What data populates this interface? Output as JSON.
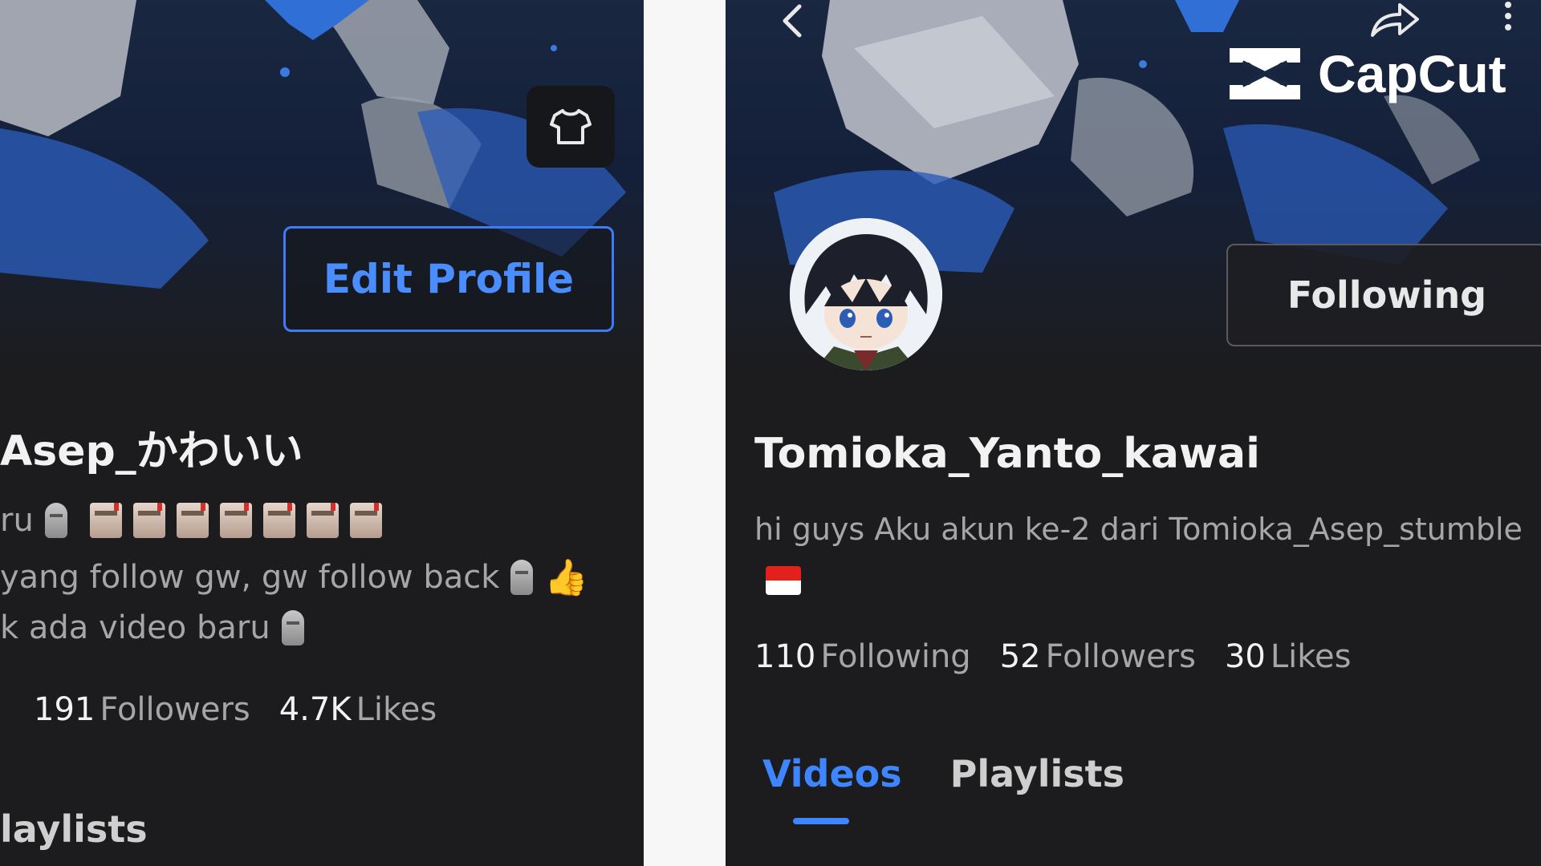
{
  "left_profile": {
    "edit_profile_label": "Edit Profile",
    "username": "Asep_かわいい",
    "bio_line1": "ru",
    "bio_line2": "yang follow gw, gw follow back",
    "bio_line3": "k ada video baru",
    "stats": {
      "followers_count": "191",
      "followers_label": "Followers",
      "likes_count": "4.7K",
      "likes_label": "Likes"
    },
    "tab_playlists": "laylists",
    "icons": [
      "shirt-icon",
      "moai-emoji",
      "package-emoji",
      "thumbs-up-emoji"
    ]
  },
  "right_profile": {
    "logo_text": "CapCut",
    "following_button_label": "Following",
    "username": "Tomioka_Yanto_kawai",
    "bio": "hi guys Aku akun ke-2 dari Tomioka_Asep_stumble",
    "stats": {
      "following_count": "110",
      "following_label": "Following",
      "followers_count": "52",
      "followers_label": "Followers",
      "likes_count": "30",
      "likes_label": "Likes"
    },
    "tabs": {
      "videos": "Videos",
      "playlists": "Playlists",
      "active": "Videos"
    },
    "icons": [
      "back-icon",
      "share-icon",
      "more-icon",
      "indonesia-flag-emoji"
    ]
  },
  "colors": {
    "accent_blue": "#3d86ff",
    "background": "#1c1c1e",
    "muted_text": "#a6a6a8"
  }
}
